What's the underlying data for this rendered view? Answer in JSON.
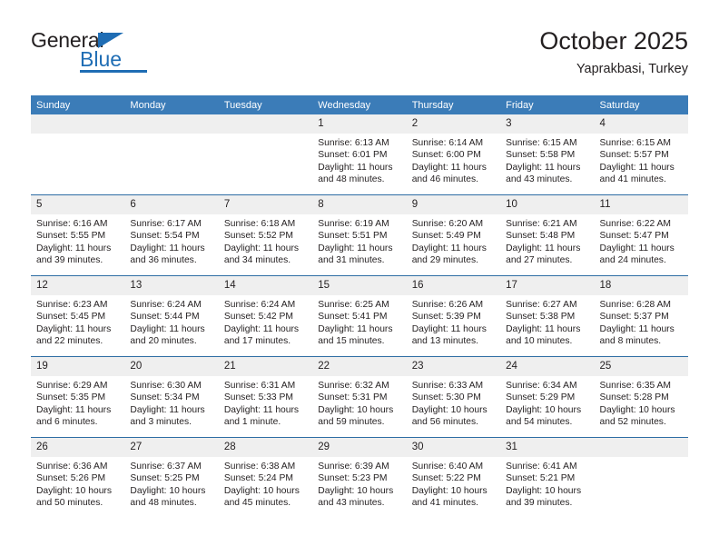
{
  "logo": {
    "general_text": "General",
    "blue_text": "Blue",
    "triangle_color": "#1f6db4"
  },
  "header": {
    "title": "October 2025",
    "subtitle": "Yaprakbasi, Turkey"
  },
  "colors": {
    "header_blue": "#3b7cb8",
    "row_rule_blue": "#2e6da4",
    "daynum_band": "#efefef",
    "text": "#231f20"
  },
  "columns": [
    "Sunday",
    "Monday",
    "Tuesday",
    "Wednesday",
    "Thursday",
    "Friday",
    "Saturday"
  ],
  "weeks": [
    [
      {
        "day": "",
        "empty": true
      },
      {
        "day": "",
        "empty": true
      },
      {
        "day": "",
        "empty": true
      },
      {
        "day": "1",
        "sunrise": "Sunrise: 6:13 AM",
        "sunset": "Sunset: 6:01 PM",
        "daylight1": "Daylight: 11 hours",
        "daylight2": "and 48 minutes."
      },
      {
        "day": "2",
        "sunrise": "Sunrise: 6:14 AM",
        "sunset": "Sunset: 6:00 PM",
        "daylight1": "Daylight: 11 hours",
        "daylight2": "and 46 minutes."
      },
      {
        "day": "3",
        "sunrise": "Sunrise: 6:15 AM",
        "sunset": "Sunset: 5:58 PM",
        "daylight1": "Daylight: 11 hours",
        "daylight2": "and 43 minutes."
      },
      {
        "day": "4",
        "sunrise": "Sunrise: 6:15 AM",
        "sunset": "Sunset: 5:57 PM",
        "daylight1": "Daylight: 11 hours",
        "daylight2": "and 41 minutes."
      }
    ],
    [
      {
        "day": "5",
        "sunrise": "Sunrise: 6:16 AM",
        "sunset": "Sunset: 5:55 PM",
        "daylight1": "Daylight: 11 hours",
        "daylight2": "and 39 minutes."
      },
      {
        "day": "6",
        "sunrise": "Sunrise: 6:17 AM",
        "sunset": "Sunset: 5:54 PM",
        "daylight1": "Daylight: 11 hours",
        "daylight2": "and 36 minutes."
      },
      {
        "day": "7",
        "sunrise": "Sunrise: 6:18 AM",
        "sunset": "Sunset: 5:52 PM",
        "daylight1": "Daylight: 11 hours",
        "daylight2": "and 34 minutes."
      },
      {
        "day": "8",
        "sunrise": "Sunrise: 6:19 AM",
        "sunset": "Sunset: 5:51 PM",
        "daylight1": "Daylight: 11 hours",
        "daylight2": "and 31 minutes."
      },
      {
        "day": "9",
        "sunrise": "Sunrise: 6:20 AM",
        "sunset": "Sunset: 5:49 PM",
        "daylight1": "Daylight: 11 hours",
        "daylight2": "and 29 minutes."
      },
      {
        "day": "10",
        "sunrise": "Sunrise: 6:21 AM",
        "sunset": "Sunset: 5:48 PM",
        "daylight1": "Daylight: 11 hours",
        "daylight2": "and 27 minutes."
      },
      {
        "day": "11",
        "sunrise": "Sunrise: 6:22 AM",
        "sunset": "Sunset: 5:47 PM",
        "daylight1": "Daylight: 11 hours",
        "daylight2": "and 24 minutes."
      }
    ],
    [
      {
        "day": "12",
        "sunrise": "Sunrise: 6:23 AM",
        "sunset": "Sunset: 5:45 PM",
        "daylight1": "Daylight: 11 hours",
        "daylight2": "and 22 minutes."
      },
      {
        "day": "13",
        "sunrise": "Sunrise: 6:24 AM",
        "sunset": "Sunset: 5:44 PM",
        "daylight1": "Daylight: 11 hours",
        "daylight2": "and 20 minutes."
      },
      {
        "day": "14",
        "sunrise": "Sunrise: 6:24 AM",
        "sunset": "Sunset: 5:42 PM",
        "daylight1": "Daylight: 11 hours",
        "daylight2": "and 17 minutes."
      },
      {
        "day": "15",
        "sunrise": "Sunrise: 6:25 AM",
        "sunset": "Sunset: 5:41 PM",
        "daylight1": "Daylight: 11 hours",
        "daylight2": "and 15 minutes."
      },
      {
        "day": "16",
        "sunrise": "Sunrise: 6:26 AM",
        "sunset": "Sunset: 5:39 PM",
        "daylight1": "Daylight: 11 hours",
        "daylight2": "and 13 minutes."
      },
      {
        "day": "17",
        "sunrise": "Sunrise: 6:27 AM",
        "sunset": "Sunset: 5:38 PM",
        "daylight1": "Daylight: 11 hours",
        "daylight2": "and 10 minutes."
      },
      {
        "day": "18",
        "sunrise": "Sunrise: 6:28 AM",
        "sunset": "Sunset: 5:37 PM",
        "daylight1": "Daylight: 11 hours",
        "daylight2": "and 8 minutes."
      }
    ],
    [
      {
        "day": "19",
        "sunrise": "Sunrise: 6:29 AM",
        "sunset": "Sunset: 5:35 PM",
        "daylight1": "Daylight: 11 hours",
        "daylight2": "and 6 minutes."
      },
      {
        "day": "20",
        "sunrise": "Sunrise: 6:30 AM",
        "sunset": "Sunset: 5:34 PM",
        "daylight1": "Daylight: 11 hours",
        "daylight2": "and 3 minutes."
      },
      {
        "day": "21",
        "sunrise": "Sunrise: 6:31 AM",
        "sunset": "Sunset: 5:33 PM",
        "daylight1": "Daylight: 11 hours",
        "daylight2": "and 1 minute."
      },
      {
        "day": "22",
        "sunrise": "Sunrise: 6:32 AM",
        "sunset": "Sunset: 5:31 PM",
        "daylight1": "Daylight: 10 hours",
        "daylight2": "and 59 minutes."
      },
      {
        "day": "23",
        "sunrise": "Sunrise: 6:33 AM",
        "sunset": "Sunset: 5:30 PM",
        "daylight1": "Daylight: 10 hours",
        "daylight2": "and 56 minutes."
      },
      {
        "day": "24",
        "sunrise": "Sunrise: 6:34 AM",
        "sunset": "Sunset: 5:29 PM",
        "daylight1": "Daylight: 10 hours",
        "daylight2": "and 54 minutes."
      },
      {
        "day": "25",
        "sunrise": "Sunrise: 6:35 AM",
        "sunset": "Sunset: 5:28 PM",
        "daylight1": "Daylight: 10 hours",
        "daylight2": "and 52 minutes."
      }
    ],
    [
      {
        "day": "26",
        "sunrise": "Sunrise: 6:36 AM",
        "sunset": "Sunset: 5:26 PM",
        "daylight1": "Daylight: 10 hours",
        "daylight2": "and 50 minutes."
      },
      {
        "day": "27",
        "sunrise": "Sunrise: 6:37 AM",
        "sunset": "Sunset: 5:25 PM",
        "daylight1": "Daylight: 10 hours",
        "daylight2": "and 48 minutes."
      },
      {
        "day": "28",
        "sunrise": "Sunrise: 6:38 AM",
        "sunset": "Sunset: 5:24 PM",
        "daylight1": "Daylight: 10 hours",
        "daylight2": "and 45 minutes."
      },
      {
        "day": "29",
        "sunrise": "Sunrise: 6:39 AM",
        "sunset": "Sunset: 5:23 PM",
        "daylight1": "Daylight: 10 hours",
        "daylight2": "and 43 minutes."
      },
      {
        "day": "30",
        "sunrise": "Sunrise: 6:40 AM",
        "sunset": "Sunset: 5:22 PM",
        "daylight1": "Daylight: 10 hours",
        "daylight2": "and 41 minutes."
      },
      {
        "day": "31",
        "sunrise": "Sunrise: 6:41 AM",
        "sunset": "Sunset: 5:21 PM",
        "daylight1": "Daylight: 10 hours",
        "daylight2": "and 39 minutes."
      },
      {
        "day": "",
        "empty": true
      }
    ]
  ]
}
